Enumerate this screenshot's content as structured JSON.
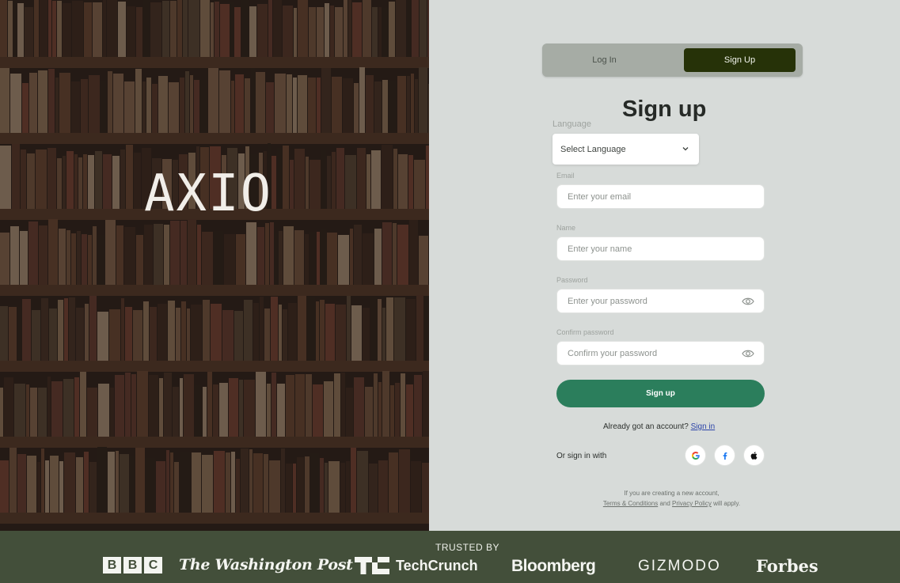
{
  "brand": {
    "name": "AXIO"
  },
  "auth_tabs": {
    "login": "Log In",
    "signup": "Sign Up",
    "active": "signup"
  },
  "form": {
    "title": "Sign up",
    "language": {
      "label": "Language",
      "value": "Select Language"
    },
    "email": {
      "label": "Email",
      "placeholder": "Enter your email"
    },
    "name": {
      "label": "Name",
      "placeholder": "Enter your name"
    },
    "password": {
      "label": "Password",
      "placeholder": "Enter your password"
    },
    "confirm": {
      "label": "Confirm password",
      "placeholder": "Confirm your password"
    },
    "submit": "Sign up",
    "already_text": "Already got an account?",
    "signin_link": "Sign in",
    "or_text": "Or sign in with",
    "social": [
      "google-icon",
      "facebook-icon",
      "apple-icon"
    ],
    "terms": {
      "line1": "If you are creating a new account,",
      "terms_link": "Terms & Conditions",
      "and": "and",
      "privacy_link": "Privacy Policy",
      "tail": "will apply."
    }
  },
  "footer": {
    "trusted_by": "TRUSTED BY",
    "logos": {
      "bbc": [
        "B",
        "B",
        "C"
      ],
      "washington_post": "The Washington Post",
      "techcrunch": "TechCrunch",
      "bloomberg": "Bloomberg",
      "gizmodo": "GIZMODO",
      "forbes": "Forbes"
    }
  },
  "colors": {
    "accent_green": "#2b7e5c",
    "tab_active": "#263208",
    "footer_bg": "#434f3a",
    "panel_bg": "#d7dbd9"
  }
}
